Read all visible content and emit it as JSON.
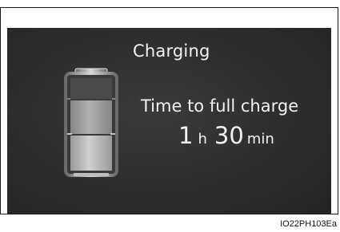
{
  "display": {
    "title": "Charging",
    "time_label": "Time to full charge",
    "hours_value": "1",
    "hours_unit": "h",
    "minutes_value": "30",
    "minutes_unit": "min"
  },
  "battery": {
    "icon": "battery-icon",
    "charge_level_fraction": 0.75
  },
  "figure_id": "IO22PH103Ea",
  "colors": {
    "screen_bg": "#2c2c2c",
    "text": "#f2f2f2",
    "battery_fill": "#b8b8b8"
  }
}
